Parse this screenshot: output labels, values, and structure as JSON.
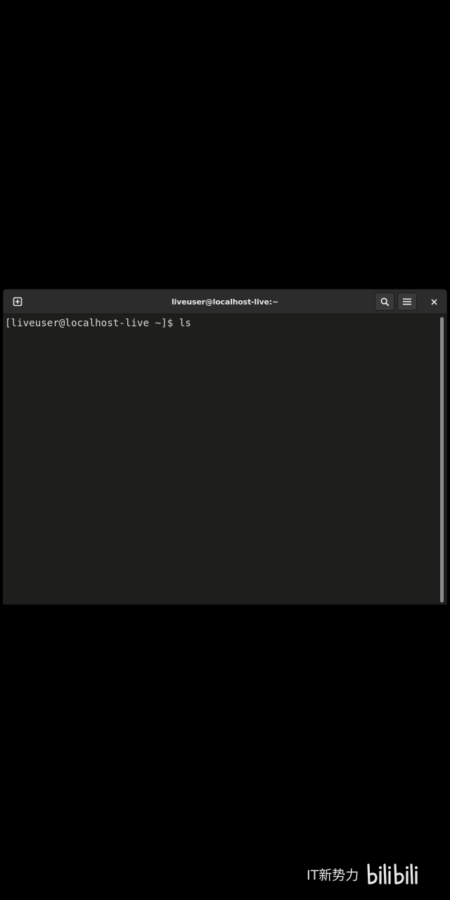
{
  "window": {
    "title": "liveuser@localhost-live:~"
  },
  "toolbar": {
    "new_tab_icon": "new-tab-icon",
    "search_icon": "search-icon",
    "menu_icon": "hamburger-menu-icon",
    "close_icon": "close-icon"
  },
  "terminal": {
    "lines": [
      "[liveuser@localhost-live ~]$ ls"
    ]
  },
  "watermark": {
    "text": "IT新势力",
    "logo": "bilibili"
  },
  "colors": {
    "background": "#000000",
    "terminal_bg": "#1e1f1d",
    "titlebar_bg": "#2c2c2c",
    "text": "#d8d8d5"
  }
}
